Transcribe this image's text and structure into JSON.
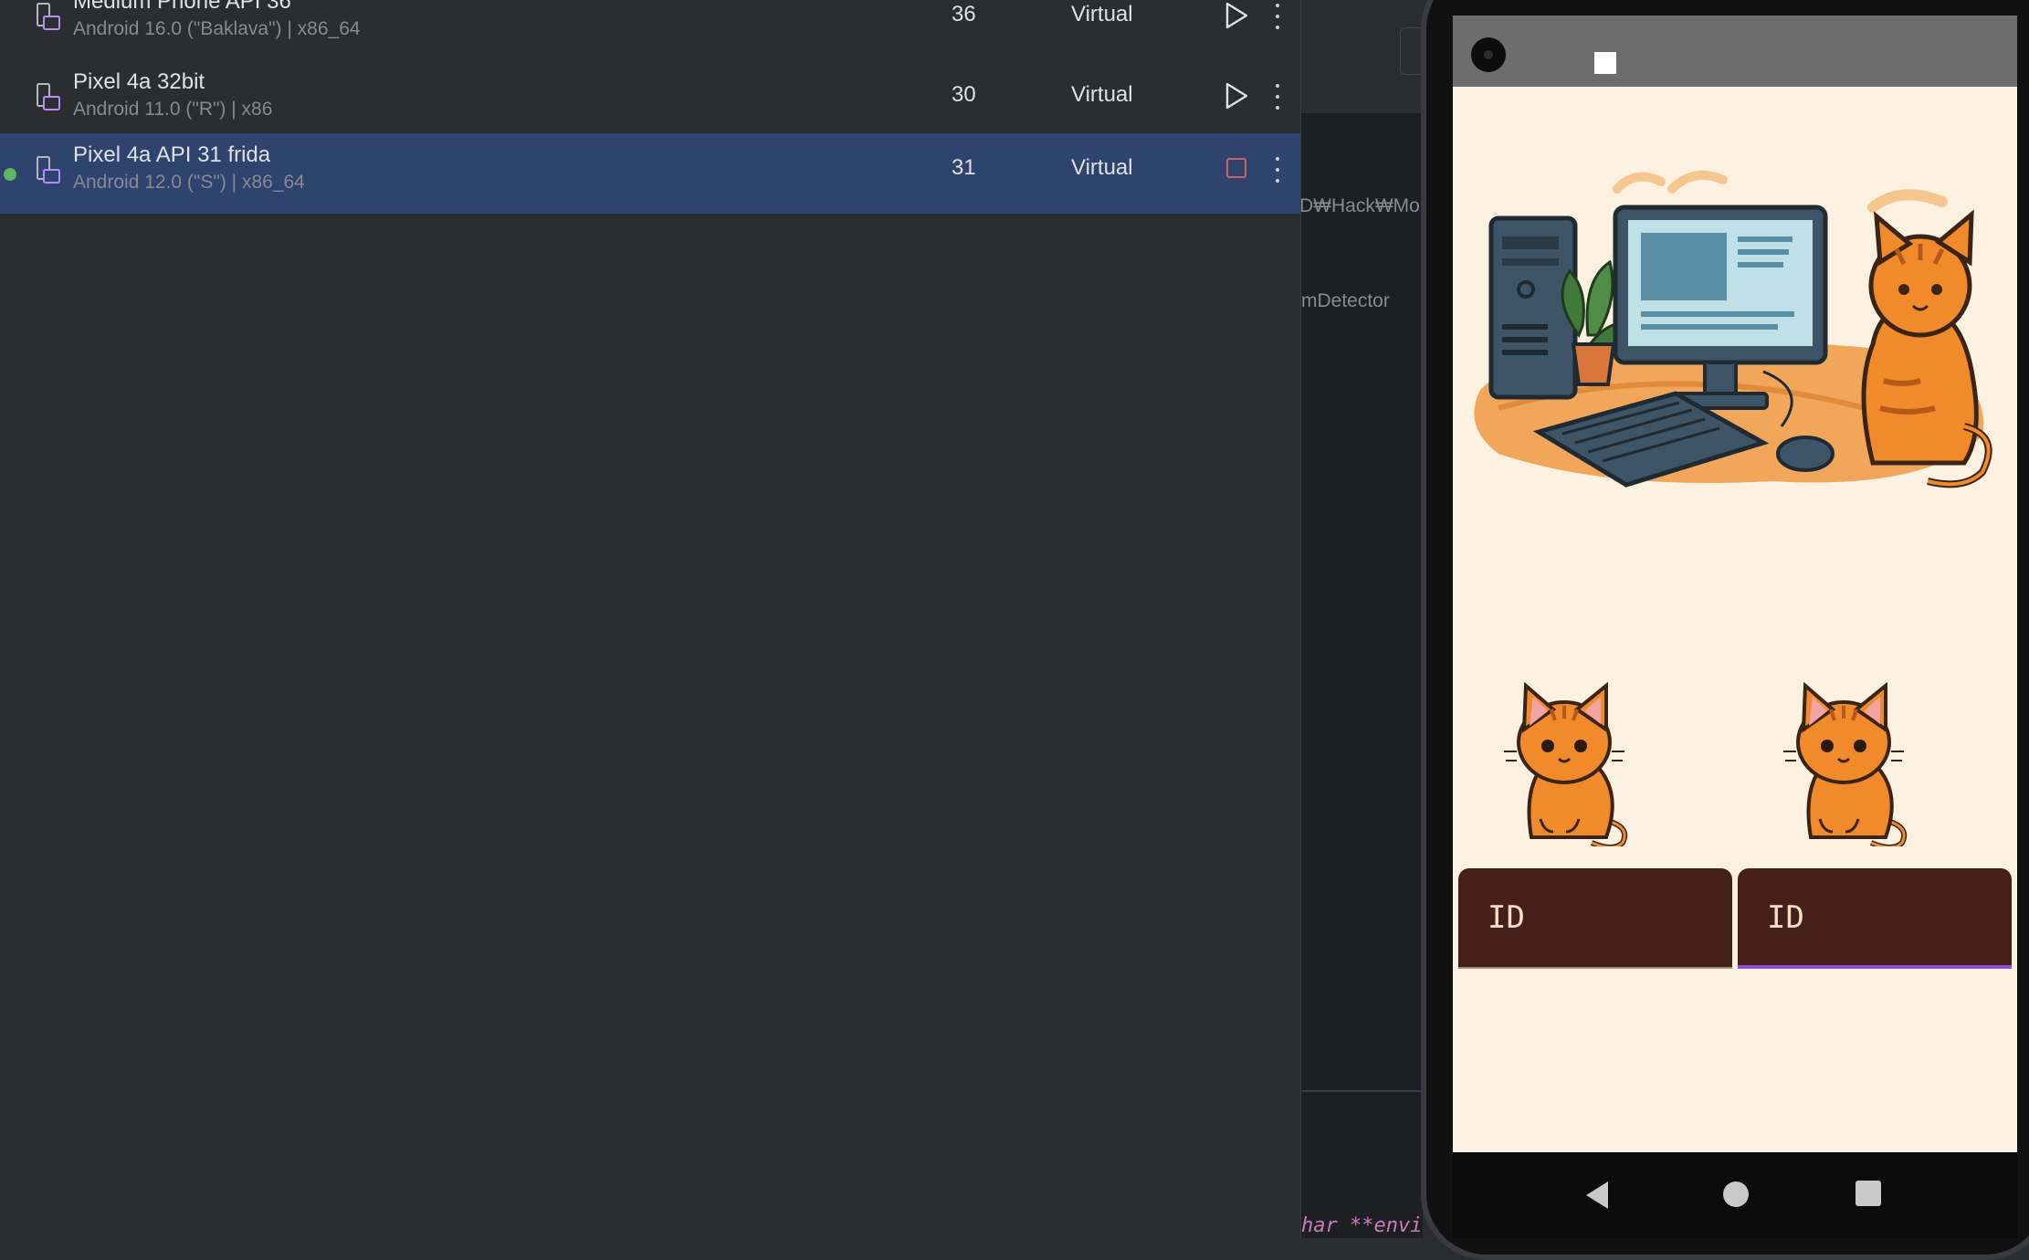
{
  "devices": [
    {
      "name": "Medium Phone API 36",
      "details": "Android 16.0 (\"Baklava\") | x86_64",
      "api": "36",
      "type": "Virtual",
      "running": false
    },
    {
      "name": "Pixel 4a 32bit",
      "details": "Android 11.0 (\"R\") | x86",
      "api": "30",
      "type": "Virtual",
      "running": false
    },
    {
      "name": "Pixel 4a API 31 frida",
      "details": "Android 12.0 (\"S\") | x86_64",
      "api": "31",
      "type": "Virtual",
      "running": true
    }
  ],
  "editor": {
    "path_fragment": "D₩Hack₩Mob",
    "class_fragment": "mDetector",
    "code_fragment": "har **envi"
  },
  "app": {
    "id_field_left": "ID",
    "id_field_right": "ID"
  },
  "colors": {
    "selected_row": "#2e436e",
    "running_dot": "#5fb85f",
    "stop_red": "#db5c5c",
    "app_background": "#fdf2e1",
    "id_field_bg": "#45201a",
    "focus_underline": "#8a4fd6"
  },
  "icons": {
    "device": "device-phone-icon",
    "run": "play-icon",
    "stop": "stop-icon",
    "more": "more-vertical-icon",
    "nav_back": "back-triangle-icon",
    "nav_home": "home-circle-icon",
    "nav_recents": "recents-square-icon"
  }
}
